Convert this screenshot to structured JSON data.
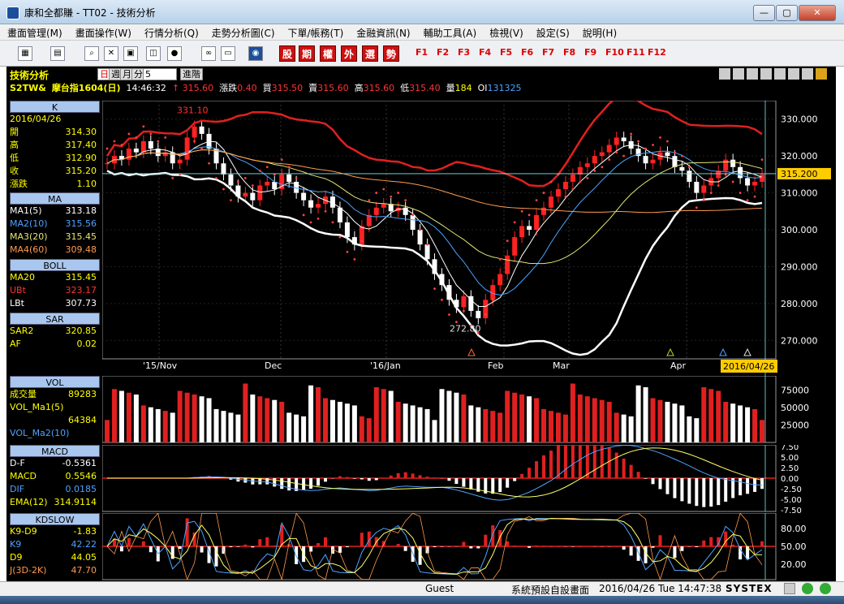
{
  "window": {
    "title": "康和全都賺 - TT02 - 技術分析",
    "buttons": [
      "—",
      "▢",
      "✕"
    ]
  },
  "menu": [
    "畫面管理(M)",
    "畫面操作(W)",
    "行情分析(Q)",
    "走勢分析圖(C)",
    "下單/帳務(T)",
    "金融資訊(N)",
    "輔助工具(A)",
    "檢視(V)",
    "設定(S)",
    "說明(H)"
  ],
  "toolbar": {
    "red_buttons": [
      "股",
      "期",
      "權",
      "外",
      "選",
      "勢"
    ],
    "fkeys": [
      "F1",
      "F2",
      "F3",
      "F4",
      "F5",
      "F6",
      "F7",
      "F8",
      "F9",
      "F10",
      "F11",
      "F12"
    ]
  },
  "chart_header": {
    "title": "技術分析",
    "period_tabs": [
      "日",
      "週",
      "月",
      "分"
    ],
    "period_value": "5",
    "advanced": "進階",
    "symbol": "S2TW&",
    "name": "摩台指1604(日)",
    "time": "14:46:32",
    "arrow": "↑",
    "last": "315.60",
    "change_label": "漲跌",
    "change": "0.40",
    "bid_label": "買",
    "bid": "315.50",
    "ask_label": "賣",
    "ask": "315.60",
    "high_label": "高",
    "high": "315.60",
    "low_label": "低",
    "low": "315.40",
    "vol_label": "量",
    "vol": "184",
    "oi_label": "OI",
    "oi": "131325"
  },
  "k_panel": {
    "head": "K",
    "date": "2016/04/26",
    "rows": [
      {
        "label": "開",
        "value": "314.30"
      },
      {
        "label": "高",
        "value": "317.40"
      },
      {
        "label": "低",
        "value": "312.90"
      },
      {
        "label": "收",
        "value": "315.20"
      },
      {
        "label": "漲跌",
        "value": "1.10"
      }
    ]
  },
  "ma_panel": {
    "head": "MA",
    "rows": [
      {
        "label": "MA1(5)",
        "value": "313.18",
        "color": "#ffffff"
      },
      {
        "label": "MA2(10)",
        "value": "315.56",
        "color": "#4da3ff"
      },
      {
        "label": "MA3(20)",
        "value": "315.45",
        "color": "#e6e676"
      },
      {
        "label": "MA4(60)",
        "value": "309.48",
        "color": "#ff9a4d"
      }
    ]
  },
  "boll_panel": {
    "head": "BOLL",
    "rows": [
      {
        "label": "MA20",
        "value": "315.45",
        "color": "#ffff00"
      },
      {
        "label": "UBt",
        "value": "323.17",
        "color": "#ff3333"
      },
      {
        "label": "LBt",
        "value": "307.73",
        "color": "#ffffff"
      }
    ]
  },
  "sar_panel": {
    "head": "SAR",
    "rows": [
      {
        "label": "SAR2",
        "value": "320.85",
        "color": "#ffff00"
      },
      {
        "label": "AF",
        "value": "0.02",
        "color": "#ffff00"
      }
    ]
  },
  "vol_panel": {
    "head": "VOL",
    "rows": [
      {
        "label": "成交量",
        "value": "89283",
        "color": "#ffff00"
      },
      {
        "label": "VOL_Ma1(5)",
        "value": "",
        "color": "#ffff00"
      },
      {
        "label": "",
        "value": "64384",
        "color": "#ffff00"
      },
      {
        "label": "VOL_Ma2(10)",
        "value": "",
        "color": "#4da3ff"
      }
    ]
  },
  "macd_panel": {
    "head": "MACD",
    "rows": [
      {
        "label": "D-F",
        "value": "-0.5361",
        "color": "#ffffff"
      },
      {
        "label": "MACD",
        "value": "0.5546",
        "color": "#ffff00"
      },
      {
        "label": "DIF",
        "value": "0.0185",
        "color": "#4da3ff"
      },
      {
        "label": "EMA(12)",
        "value": "314.9114",
        "color": "#ffff00"
      }
    ]
  },
  "kd_panel": {
    "head": "KDSLOW",
    "rows": [
      {
        "label": "K9-D9",
        "value": "-1.83",
        "color": "#ffff00"
      },
      {
        "label": "K9",
        "value": "42.22",
        "color": "#4da3ff"
      },
      {
        "label": "D9",
        "value": "44.05",
        "color": "#ffff00"
      },
      {
        "label": "J(3D-2K)",
        "value": "47.70",
        "color": "#ff9a4d"
      }
    ]
  },
  "price_axis": [
    "330.000",
    "320.000",
    "310.000",
    "300.000",
    "290.000",
    "280.000",
    "270.000"
  ],
  "price_marker": "315.200",
  "date_axis": [
    "'15/Nov",
    "Dec",
    "'16/Jan",
    "Feb",
    "Mar",
    "Apr"
  ],
  "date_marker": "2016/04/26",
  "annotations": {
    "high": "331.10",
    "low": "272.80"
  },
  "vol_axis": [
    "75000",
    "50000",
    "25000"
  ],
  "macd_axis": [
    "7.50",
    "5.00",
    "2.50",
    "0.00",
    "-2.50",
    "-5.00",
    "-7.50"
  ],
  "kd_axis": [
    "80.00",
    "50.00",
    "20.00"
  ],
  "status": {
    "user": "Guest",
    "layout": "系統預設自設畫面",
    "datetime": "2016/04/26 Tue 14:47:38",
    "brand": "SYSTEX"
  },
  "chart_data": {
    "type": "candlestick",
    "y_range": [
      265,
      335
    ],
    "closes": [
      318,
      320,
      319,
      322,
      321,
      324,
      322,
      320,
      321,
      318,
      319,
      325,
      328,
      326,
      322,
      318,
      315,
      312,
      309,
      310,
      308,
      312,
      313,
      311,
      315,
      313,
      310,
      308,
      306,
      307,
      309,
      306,
      302,
      298,
      296,
      301,
      304,
      306,
      307,
      305,
      306,
      304,
      300,
      296,
      292,
      288,
      285,
      281,
      279,
      282,
      278,
      276,
      281,
      285,
      288,
      293,
      298,
      301,
      300,
      304,
      306,
      309,
      311,
      313,
      315,
      317,
      318,
      320,
      321,
      323,
      325,
      324,
      322,
      320,
      318,
      319,
      321,
      320,
      317,
      316,
      313,
      310,
      312,
      314,
      316,
      319,
      317,
      314,
      312,
      313,
      315
    ]
  }
}
